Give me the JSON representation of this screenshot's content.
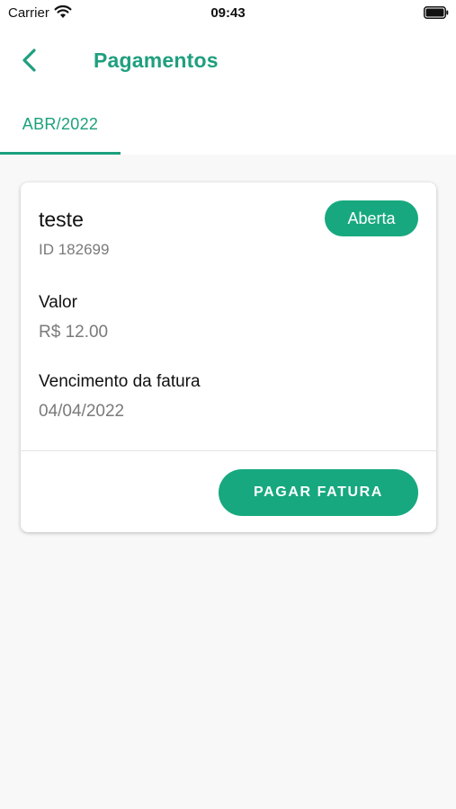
{
  "status_bar": {
    "carrier": "Carrier",
    "time": "09:43"
  },
  "header": {
    "title": "Pagamentos",
    "back_icon": "chevron-left-icon"
  },
  "tabs": [
    {
      "label": "ABR/2022",
      "selected": true
    }
  ],
  "invoice": {
    "title": "teste",
    "id": "ID 182699",
    "status": "Aberta",
    "amount_label": "Valor",
    "amount_value": "R$ 12.00",
    "due_label": "Vencimento da fatura",
    "due_value": "04/04/2022",
    "pay_button": "PAGAR FATURA"
  },
  "colors": {
    "accent": "#17a87f",
    "background": "#f8f8f8"
  }
}
